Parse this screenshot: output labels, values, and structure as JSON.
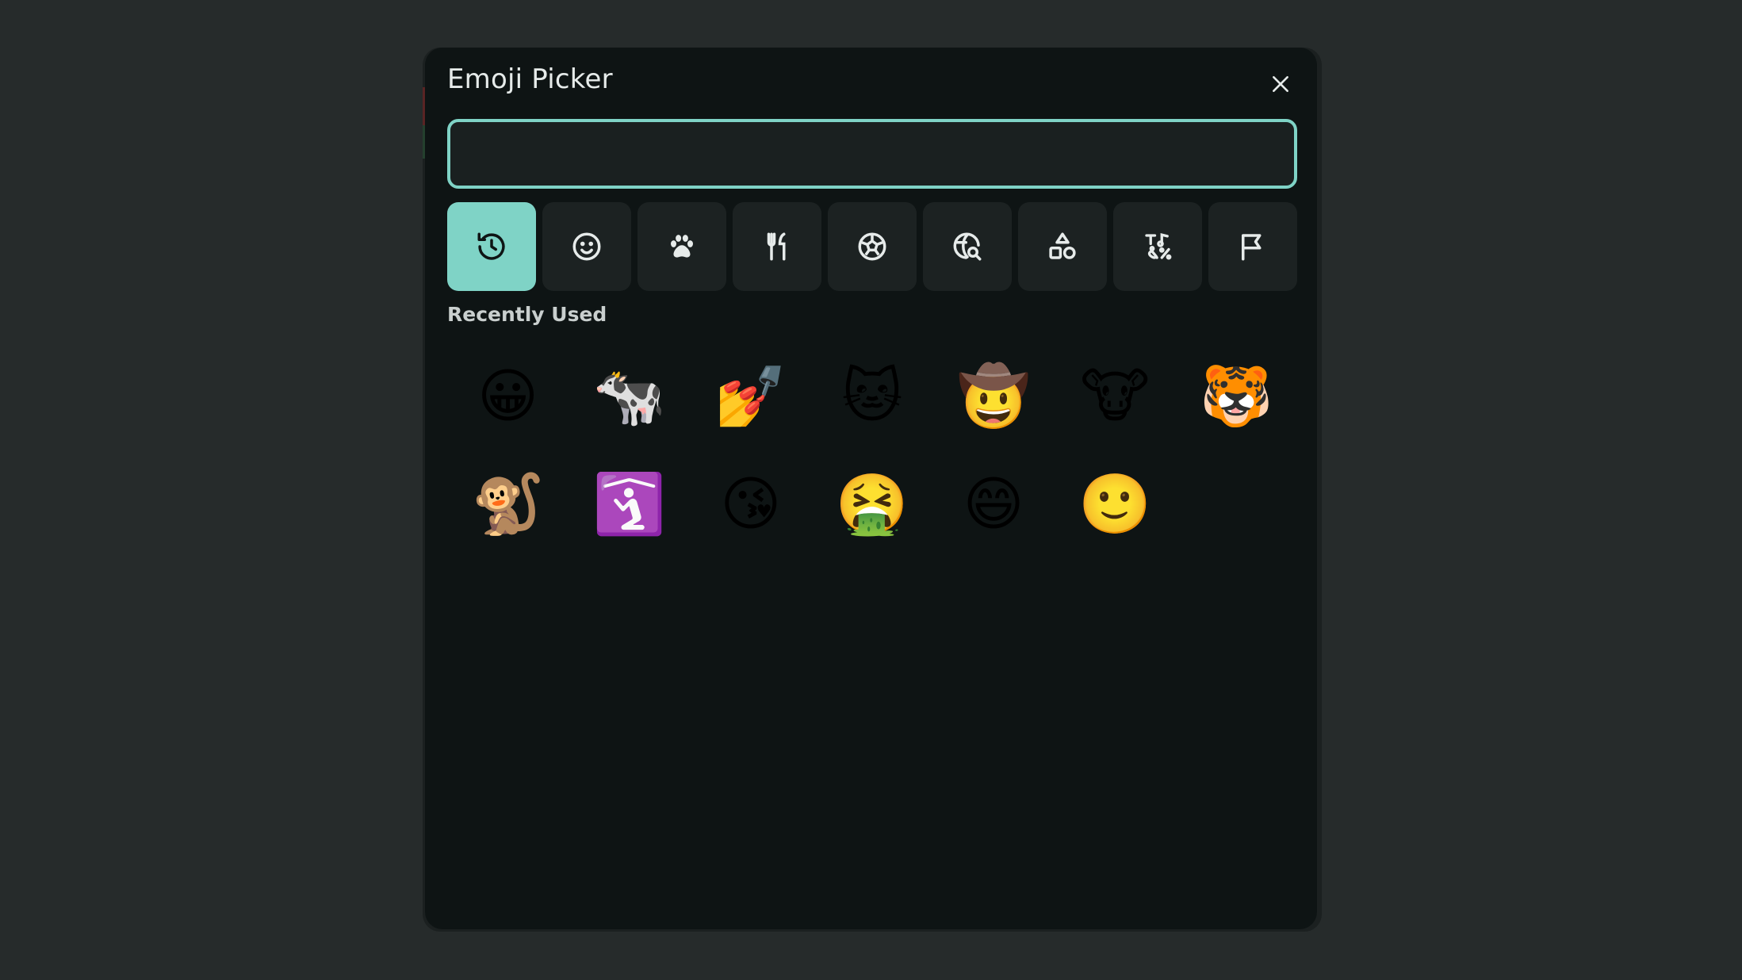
{
  "dialog": {
    "title": "Emoji Picker",
    "close_icon": "close-icon"
  },
  "search": {
    "value": "",
    "placeholder": ""
  },
  "categories": [
    {
      "icon": "clock-history-icon",
      "active": true
    },
    {
      "icon": "smiley-icon",
      "active": false
    },
    {
      "icon": "paw-icon",
      "active": false
    },
    {
      "icon": "fork-knife-icon",
      "active": false
    },
    {
      "icon": "soccer-ball-icon",
      "active": false
    },
    {
      "icon": "globe-search-icon",
      "active": false
    },
    {
      "icon": "shapes-icon",
      "active": false
    },
    {
      "icon": "symbols-icon",
      "active": false
    },
    {
      "icon": "flag-icon",
      "active": false
    }
  ],
  "colors": {
    "accent": "#7fd3c6",
    "dialog_bg": "#0e1414",
    "page_bg": "#262b2b"
  },
  "recent": {
    "label": "Recently Used",
    "emojis": [
      "😀",
      "🐄",
      "💅",
      "🐱",
      "🤠",
      "🐮",
      "🐯",
      "🐒",
      "🛐",
      "😘",
      "🤮",
      "😄",
      "🙂"
    ]
  }
}
